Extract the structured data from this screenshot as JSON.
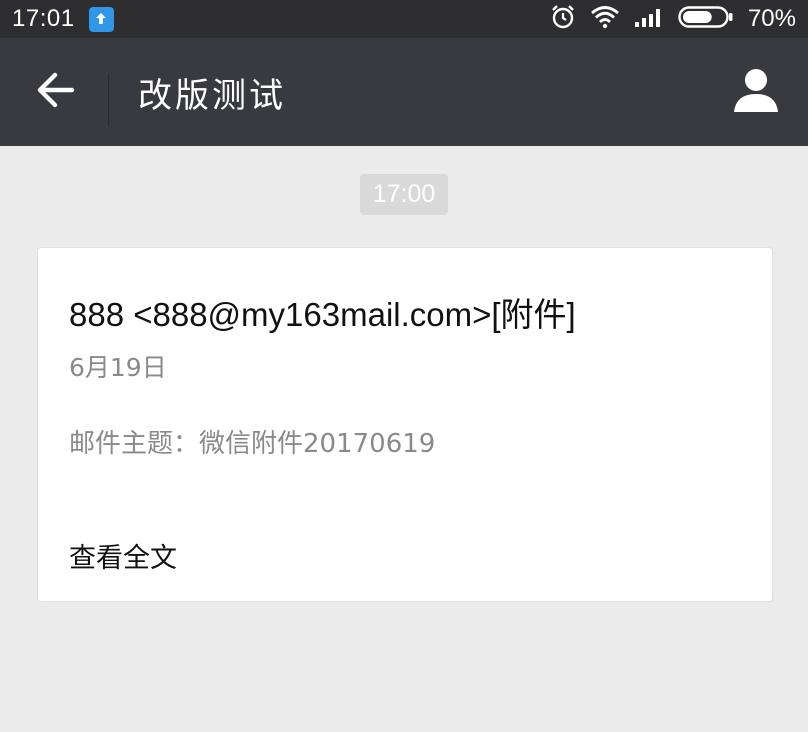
{
  "status_bar": {
    "time": "17:01",
    "battery_percent": "70%",
    "icons": [
      "upload-notification-icon",
      "alarm-icon",
      "wifi-icon",
      "signal-icon",
      "battery-icon"
    ],
    "battery_level": 0.7
  },
  "header": {
    "title": "改版测试",
    "back_icon": "back-arrow-icon",
    "profile_icon": "person-icon"
  },
  "chat": {
    "timestamp": "17:00",
    "message_card": {
      "sender": "888 <888@my163mail.com>[附件]",
      "date": "6月19日",
      "subject": "邮件主题：微信附件20170619",
      "action_label": "查看全文"
    }
  },
  "colors": {
    "status_bar_bg": "#2e2e30",
    "app_bar_bg": "#393a3f",
    "page_bg": "#ebebeb",
    "notification_blue": "#2f96e8"
  }
}
